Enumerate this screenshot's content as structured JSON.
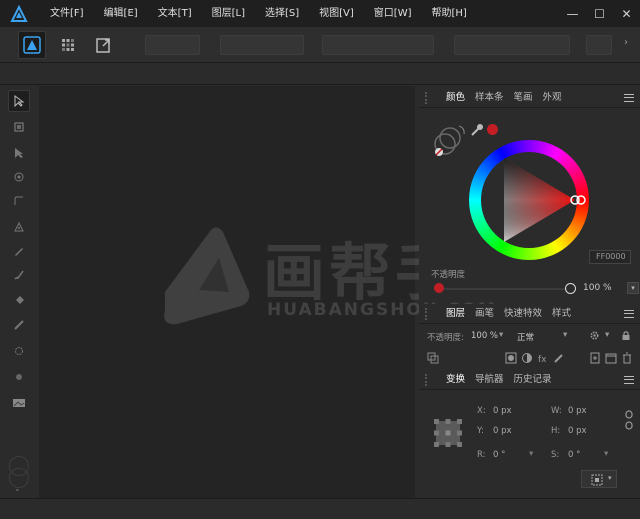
{
  "menu": [
    "文件[F]",
    "编辑[E]",
    "文本[T]",
    "图层[L]",
    "选择[S]",
    "视图[V]",
    "窗口[W]",
    "帮助[H]"
  ],
  "window_controls": {
    "minimize": "—",
    "maximize": "☐",
    "close": "✕"
  },
  "color_panel": {
    "tabs": [
      "颜色",
      "样本条",
      "笔画",
      "外观"
    ],
    "active_tab": "颜色",
    "hex_value": "FF0000",
    "opacity_label": "不透明度",
    "opacity_value": "100 %",
    "current_color": "#c41e24"
  },
  "layers_panel": {
    "tabs": [
      "图层",
      "画笔",
      "快速特效",
      "样式"
    ],
    "active_tab": "图层",
    "opacity_label": "不透明度:",
    "opacity_value": "100 %",
    "blend_mode": "正常"
  },
  "transform_panel": {
    "tabs": [
      "变换",
      "导航器",
      "历史记录"
    ],
    "active_tab": "变换",
    "fields": [
      {
        "label": "X:",
        "value": "0 px"
      },
      {
        "label": "W:",
        "value": "0 px"
      },
      {
        "label": "Y:",
        "value": "0 px"
      },
      {
        "label": "H:",
        "value": "0 px"
      },
      {
        "label": "R:",
        "value": "0 °"
      },
      {
        "label": "S:",
        "value": "0 °"
      }
    ]
  },
  "watermark": {
    "title": "画帮手",
    "subtitle": "HUABANGSHOU.COM"
  },
  "colors": {
    "accent": "#3ba3f0",
    "panel_bg": "#2b2b2b",
    "canvas_bg": "#242424"
  }
}
